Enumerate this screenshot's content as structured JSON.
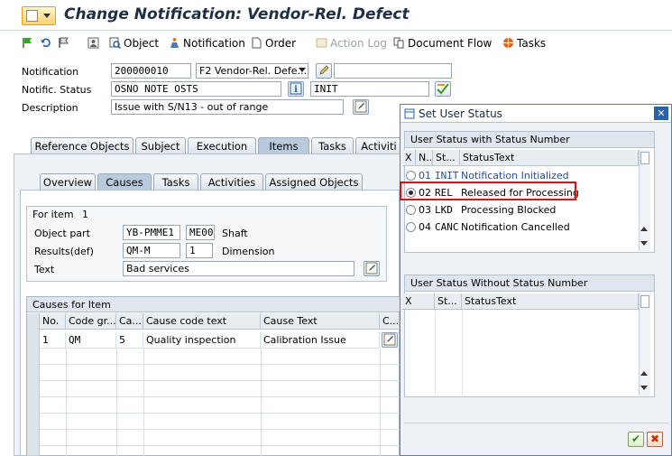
{
  "window": {
    "title": "Change Notification: Vendor-Rel. Defect"
  },
  "toolbar": {
    "object": "Object",
    "notification": "Notification",
    "order": "Order",
    "action_log": "Action Log",
    "document_flow": "Document Flow",
    "tasks": "Tasks"
  },
  "header": {
    "notification_label": "Notification",
    "notification_value": "200000010",
    "notif_type": "F2 Vendor-Rel. Defe...",
    "status_label": "Notific. Status",
    "status_value": "OSNO NOTE OSTS",
    "user_status": "INIT",
    "description_label": "Description",
    "description_value": "Issue with S/N13 - out of range"
  },
  "main_tabs": [
    "Reference Objects",
    "Subject",
    "Execution",
    "Items",
    "Tasks",
    "Activiti"
  ],
  "sub_tabs": [
    "Overview",
    "Causes",
    "Tasks",
    "Activities",
    "Assigned Objects"
  ],
  "item": {
    "for_item_label": "For item",
    "for_item_value": "1",
    "object_part_label": "Object part",
    "object_part_code": "YB-PMME1",
    "object_part_sub": "ME00",
    "object_part_text": "Shaft",
    "results_label": "Results(def)",
    "results_code": "QM-M",
    "results_num": "1",
    "results_text": "Dimension",
    "text_label": "Text",
    "text_value": "Bad services"
  },
  "causes": {
    "title": "Causes for Item",
    "columns": [
      "No.",
      "Code gr...",
      "Ca...",
      "Cause code text",
      "Cause Text",
      "C..."
    ],
    "rows": [
      {
        "no": "1",
        "code_group": "QM",
        "cause": "5",
        "cause_code_text": "Quality inspection",
        "cause_text": "Calibration Issue"
      }
    ]
  },
  "dialog": {
    "title": "Set User Status",
    "with_number_title": "User Status with Status Number",
    "with_columns": [
      "X",
      "N...",
      "St...",
      "StatusText"
    ],
    "with_rows": [
      {
        "num": "01",
        "code": "INIT",
        "text": "Notification Initialized",
        "selected": false
      },
      {
        "num": "02",
        "code": "REL",
        "text": "Released for Processing",
        "selected": true
      },
      {
        "num": "03",
        "code": "LKD",
        "text": "Processing Blocked",
        "selected": false
      },
      {
        "num": "04",
        "code": "CANC",
        "text": "Notification Cancelled",
        "selected": false
      }
    ],
    "without_number_title": "User Status Without Status Number",
    "without_columns": [
      "X",
      "St...",
      "StatusText"
    ]
  },
  "colors": {
    "accent": "#2a62a8",
    "highlight": "#e01010",
    "grid_header": "#e8edf2"
  }
}
